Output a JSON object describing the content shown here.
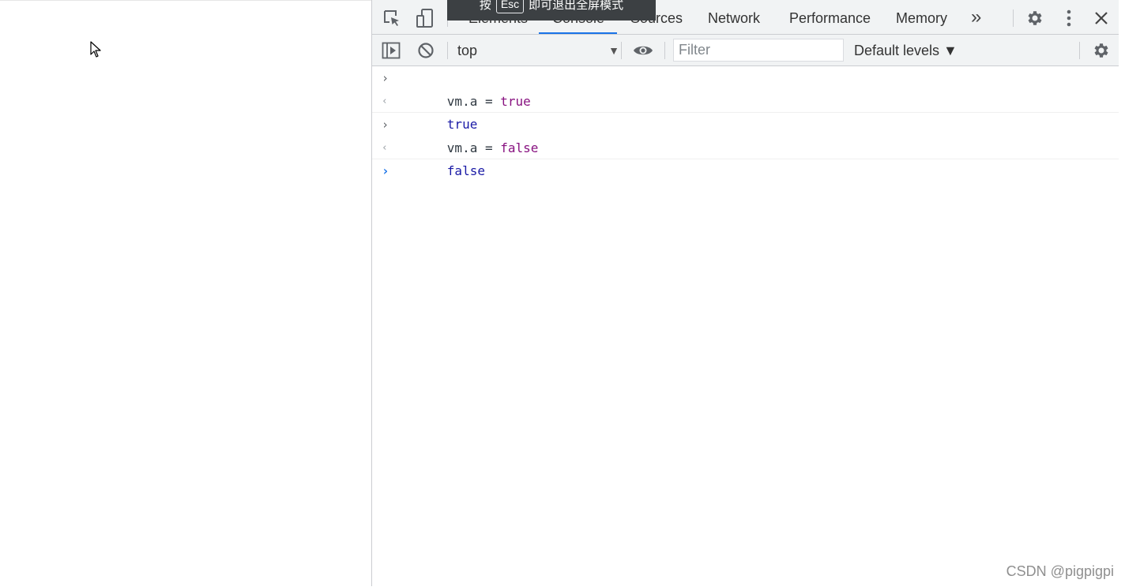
{
  "fullscreen_toast": {
    "prefix": "按",
    "key": "Esc",
    "suffix": "即可退出全屏模式"
  },
  "devtools": {
    "tabs": [
      {
        "label": "Elements"
      },
      {
        "label": "Console",
        "active": true
      },
      {
        "label": "Sources"
      },
      {
        "label": "Network"
      },
      {
        "label": "Performance"
      },
      {
        "label": "Memory"
      }
    ],
    "more_tabs_glyph": "»",
    "close_glyph": "✕",
    "icons": {
      "inspect": "inspect-element-icon",
      "device": "device-toolbar-icon",
      "settings": "gear-icon",
      "menu": "kebab-menu-icon",
      "close": "close-icon"
    }
  },
  "console_toolbar": {
    "context": "top",
    "context_arrow": "▼",
    "filter_placeholder": "Filter",
    "levels": "Default levels ▼",
    "icons": {
      "sidebar": "sidebar-toggle-icon",
      "clear": "clear-console-icon",
      "live_expression": "eye-icon",
      "settings": "gear-icon"
    }
  },
  "console": {
    "entries": [
      {
        "input": "vm.a",
        "op": " = ",
        "keyword": "true",
        "result": "true"
      },
      {
        "input": "vm.a",
        "op": " = ",
        "keyword": "false",
        "result": "false"
      }
    ],
    "input_glyph": "›",
    "result_glyph": "‹"
  },
  "watermark": "CSDN @pigpigpi",
  "colors": {
    "accent": "#1a73e8",
    "keyword": "#881280",
    "value": "#1a1aa6",
    "toolbar_bg": "#f1f3f4"
  }
}
